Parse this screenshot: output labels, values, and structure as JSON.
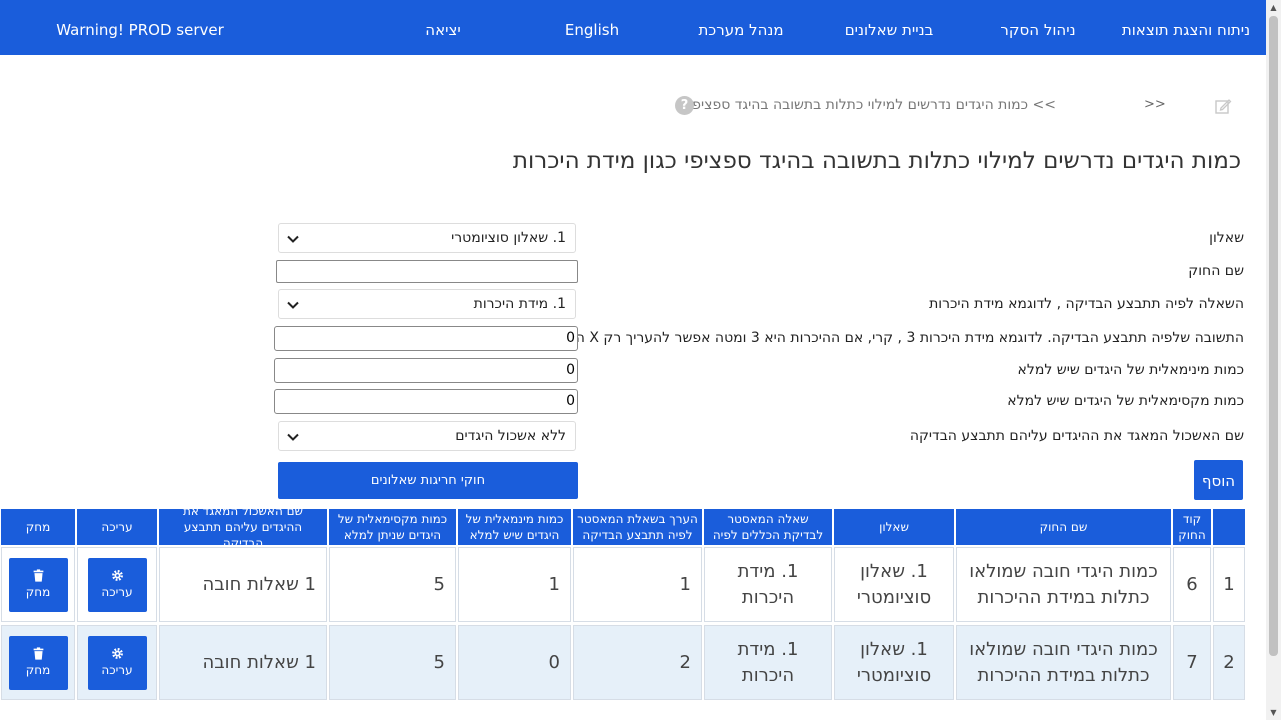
{
  "nav": {
    "items": [
      "ניתוח והצגת תוצאות",
      "ניהול הסקר",
      "בניית שאלונים",
      "מנהל מערכת",
      "English",
      "יציאה"
    ],
    "warning": "Warning! PROD server"
  },
  "breadcrumb": {
    "sep": ">>",
    "current": ">> כמות היגדים נדרשים למילוי כתלות בתשובה בהיגד ספציפי",
    "help": "?"
  },
  "page_title": "כמות היגדים נדרשים למילוי כתלות בתשובה בהיגד ספציפי כגון מידת היכרות",
  "form": {
    "questionnaire_label": "שאלון",
    "questionnaire_value": "1. שאלון סוציומטרי",
    "rule_name_label": "שם החוק",
    "rule_name_value": "",
    "question_label": "השאלה לפיה תתבצע הבדיקה , לדוגמא מידת היכרות",
    "question_value": "1. מידת היכרות",
    "answer_label": "התשובה שלפיה תתבצע הבדיקה. לדוגמא מידת היכרות 3 , קרי, אם ההיכרות היא 3 ומטה אפשר להעריך רק X היגדים.",
    "answer_value": "0",
    "min_label": "כמות מינימאלית של היגדים שיש למלא",
    "min_value": "0",
    "max_label": "כמות מקסימאלית של היגדים שיש למלא",
    "max_value": "0",
    "group_label": "שם האשכול המאגד את ההיגדים עליהם תתבצע הבדיקה",
    "group_value": "ללא אשכול היגדים",
    "add_button": "הוסף",
    "exceptions_button": "חוקי חריגות שאלונים"
  },
  "table": {
    "headers": {
      "idx": "",
      "code": "קוד החוק",
      "name": "שם החוק",
      "questionnaire": "שאלון",
      "master": "שאלה המאסטר לבדיקת הכללים לפיה",
      "value": "הערך בשאלת המאסטר לפיה תתבצע הבדיקה",
      "min": "כמות מינמאלית של היגדים שיש למלא",
      "max": "כמות מקסימאלית של היגדים שניתן למלא",
      "group": "שם האשכול המאגד את ההיגדים עליהם תתבצע הבדיקה",
      "edit": "עריכה",
      "delete": "מחק"
    },
    "rows": [
      {
        "idx": "1",
        "code": "6",
        "name": "כמות היגדי חובה שמולאו כתלות במידת ההיכרות",
        "questionnaire": "1. שאלון סוציומטרי",
        "master": "1. מידת היכרות",
        "value": "1",
        "min": "1",
        "max": "5",
        "group": "1 שאלות חובה",
        "edit": "עריכה",
        "delete": "מחק"
      },
      {
        "idx": "2",
        "code": "7",
        "name": "כמות היגדי חובה שמולאו כתלות במידת ההיכרות",
        "questionnaire": "1. שאלון סוציומטרי",
        "master": "1. מידת היכרות",
        "value": "2",
        "min": "0",
        "max": "5",
        "group": "1 שאלות חובה",
        "edit": "עריכה",
        "delete": "מחק"
      }
    ]
  },
  "colors": {
    "primary": "#1a5ddb",
    "row_alt": "#e6f0f9"
  }
}
